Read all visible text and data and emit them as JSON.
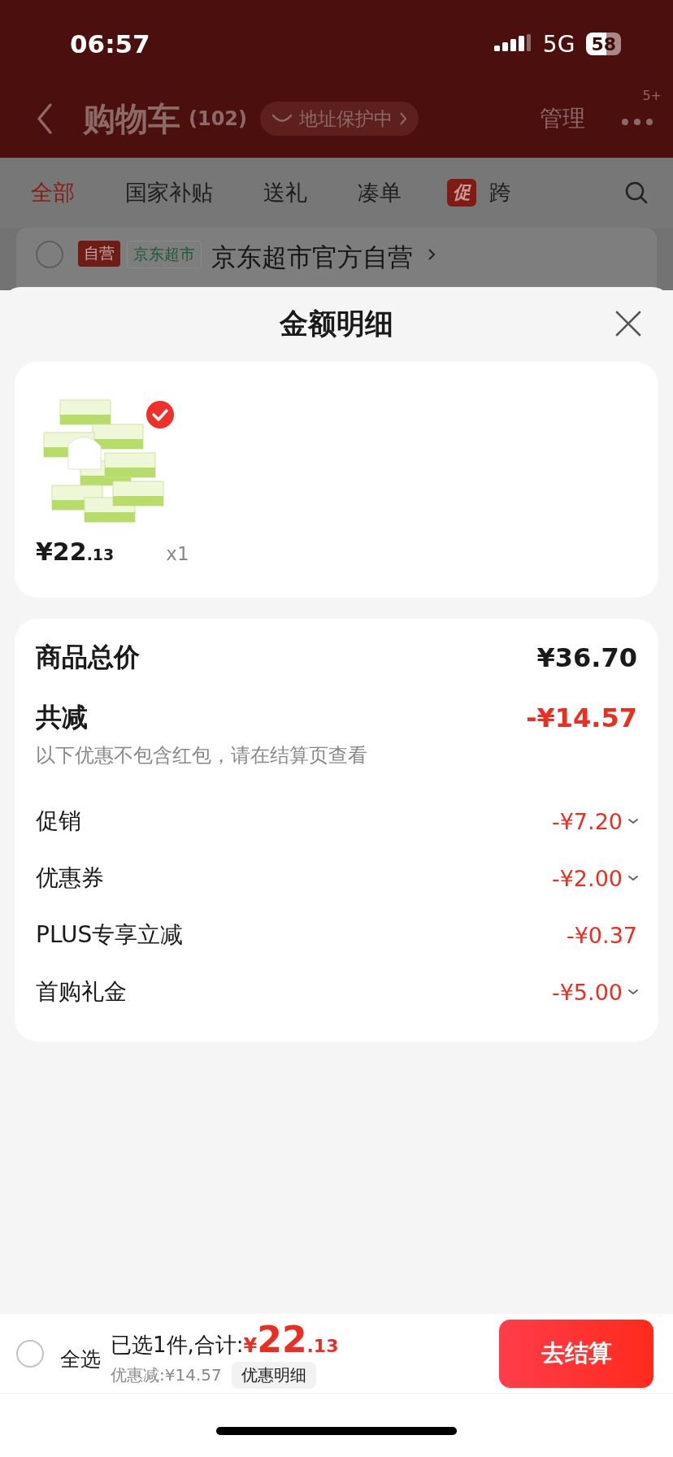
{
  "status_bar": {
    "time": "06:57",
    "network": "5G",
    "battery": "58"
  },
  "header": {
    "title": "购物车",
    "count": "(102)",
    "address_pill": "地址保护中",
    "manage": "管理",
    "more_badge": "5+"
  },
  "tabs": [
    {
      "label": "全部",
      "selected": true
    },
    {
      "label": "国家补贴",
      "selected": false
    },
    {
      "label": "送礼",
      "selected": false
    },
    {
      "label": "凑单",
      "selected": false
    },
    {
      "label": "跨",
      "selected": false,
      "badge": "促"
    }
  ],
  "store": {
    "checked": false,
    "tags": [
      {
        "text": "自营",
        "kind": "solid"
      },
      {
        "text": "京东超市",
        "kind": "outline"
      }
    ],
    "name": "京东超市官方自营"
  },
  "sheet": {
    "title": "金额明细",
    "products": [
      {
        "checked": true,
        "price_main": "¥22",
        "price_decimal": ".13",
        "quantity": "x1"
      }
    ],
    "total": {
      "label": "商品总价",
      "amount": "¥36.70"
    },
    "reduction": {
      "label": "共减",
      "amount": "-¥14.57",
      "note": "以下优惠不包含红包，请在结算页查看"
    },
    "items": [
      {
        "label": "促销",
        "amount": "-¥7.20",
        "expandable": true
      },
      {
        "label": "优惠券",
        "amount": "-¥2.00",
        "expandable": true
      },
      {
        "label": "PLUS专享立减",
        "amount": "-¥0.37",
        "expandable": false
      },
      {
        "label": "首购礼金",
        "amount": "-¥5.00",
        "expandable": true
      }
    ]
  },
  "bottom_bar": {
    "select_all": {
      "label": "全选",
      "checked": false
    },
    "summary": "已选1件,合计:",
    "currency": "¥",
    "total_main": "22",
    "total_decimal": ".13",
    "discount": "优惠减:¥14.57",
    "details_button": "优惠明细",
    "checkout": "去结算"
  }
}
